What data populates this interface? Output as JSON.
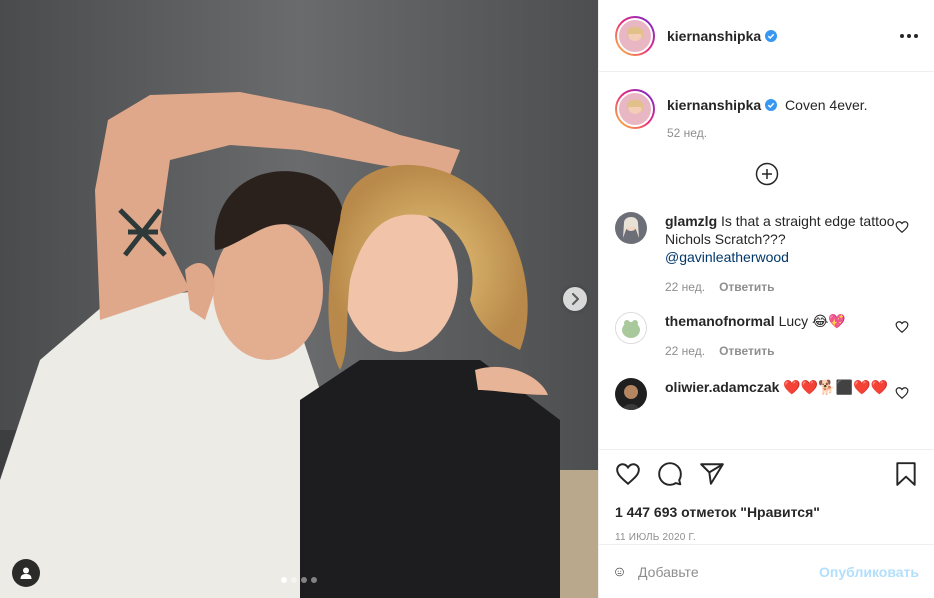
{
  "post": {
    "author": "kiernanshipka",
    "verified": true,
    "caption": "Coven 4ever.",
    "caption_age": "52 нед.",
    "carousel_total": 4,
    "carousel_index": 1
  },
  "comments": [
    {
      "user": "glamzlg",
      "text": "Is that a straight edge tattoo Nichols Scratch???",
      "mention": "@gavinleatherwood",
      "age": "22 нед.",
      "reply": "Ответить"
    },
    {
      "user": "themanofnormal",
      "text": "Lucy 😂💖",
      "age": "22 нед.",
      "reply": "Ответить"
    },
    {
      "user": "oliwier.adamczak",
      "text": "❤️❤️🐕⬛❤️❤️"
    }
  ],
  "likes": "1 447 693 отметок \"Нравится\"",
  "date": "11 ИЮЛЬ 2020 Г.",
  "comment_input": {
    "placeholder": "Добавьте",
    "value": ""
  },
  "publish_label": "Опубликовать",
  "colors": {
    "link": "#00376b",
    "publish_disabled": "#b2dffc",
    "verified": "#3897f0"
  },
  "icons": [
    "more-icon",
    "plus-circle-icon",
    "heart-icon",
    "comment-icon",
    "share-icon",
    "bookmark-icon",
    "emoji-icon",
    "chevron-right-icon",
    "user-tag-icon",
    "verified-icon"
  ]
}
